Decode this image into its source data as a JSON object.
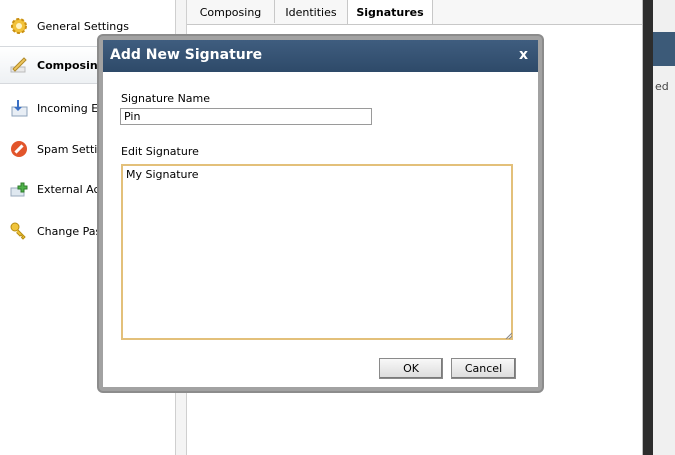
{
  "sidebar": {
    "items": [
      {
        "label": "General Settings",
        "icon": "gear-icon"
      },
      {
        "label": "Composing",
        "icon": "compose-pencil-icon"
      },
      {
        "label": "Incoming Em",
        "icon": "incoming-mail-icon"
      },
      {
        "label": "Spam Setting",
        "icon": "no-entry-icon"
      },
      {
        "label": "External Acc",
        "icon": "add-account-icon"
      },
      {
        "label": "Change Pass",
        "icon": "key-icon"
      }
    ],
    "active_index": 1
  },
  "tabs": [
    {
      "label": "Composing"
    },
    {
      "label": "Identities"
    },
    {
      "label": "Signatures"
    }
  ],
  "active_tab": "Signatures",
  "right_edge_text": "ed",
  "dialog": {
    "title": "Add New Signature",
    "close_label": "x",
    "name_label": "Signature Name",
    "name_value": "Pin",
    "edit_label": "Edit Signature",
    "edit_value": "My Signature",
    "ok_label": "OK",
    "cancel_label": "Cancel"
  },
  "colors": {
    "title_bar": "#34506f",
    "textarea_border": "#e3c07a",
    "overlay_frame": "#a2a2a2"
  }
}
